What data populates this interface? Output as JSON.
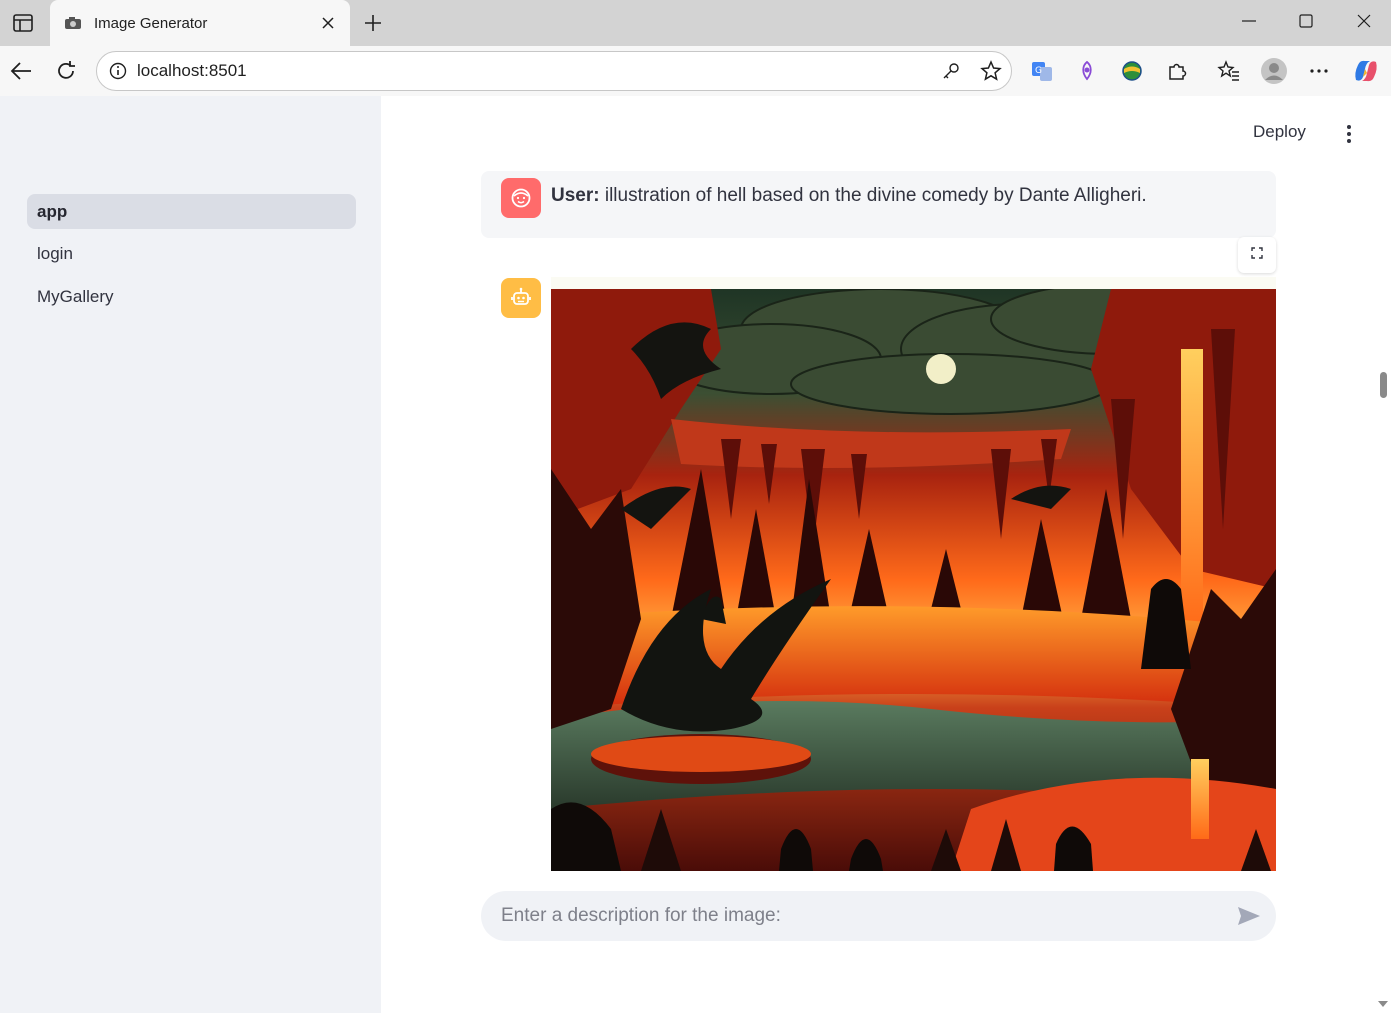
{
  "browser": {
    "tab_title": "Image Generator",
    "url": "localhost:8501"
  },
  "sidebar": {
    "items": [
      {
        "label": "app",
        "active": true
      },
      {
        "label": "login",
        "active": false
      },
      {
        "label": "MyGallery",
        "active": false
      }
    ]
  },
  "header": {
    "deploy_label": "Deploy"
  },
  "chat": {
    "user_prefix": "User:",
    "user_message": " illustration of hell based on the divine comedy by Dante Alligheri.",
    "input_placeholder": "Enter a description for the image:"
  },
  "colors": {
    "user_avatar": "#ff6b6b",
    "bot_avatar": "#ffbd45",
    "sidebar_bg": "#f0f2f6"
  },
  "icons": {
    "user_avatar": "smile-face-icon",
    "bot_avatar": "robot-icon",
    "send": "send-arrow-icon",
    "fullscreen": "fullscreen-icon"
  }
}
